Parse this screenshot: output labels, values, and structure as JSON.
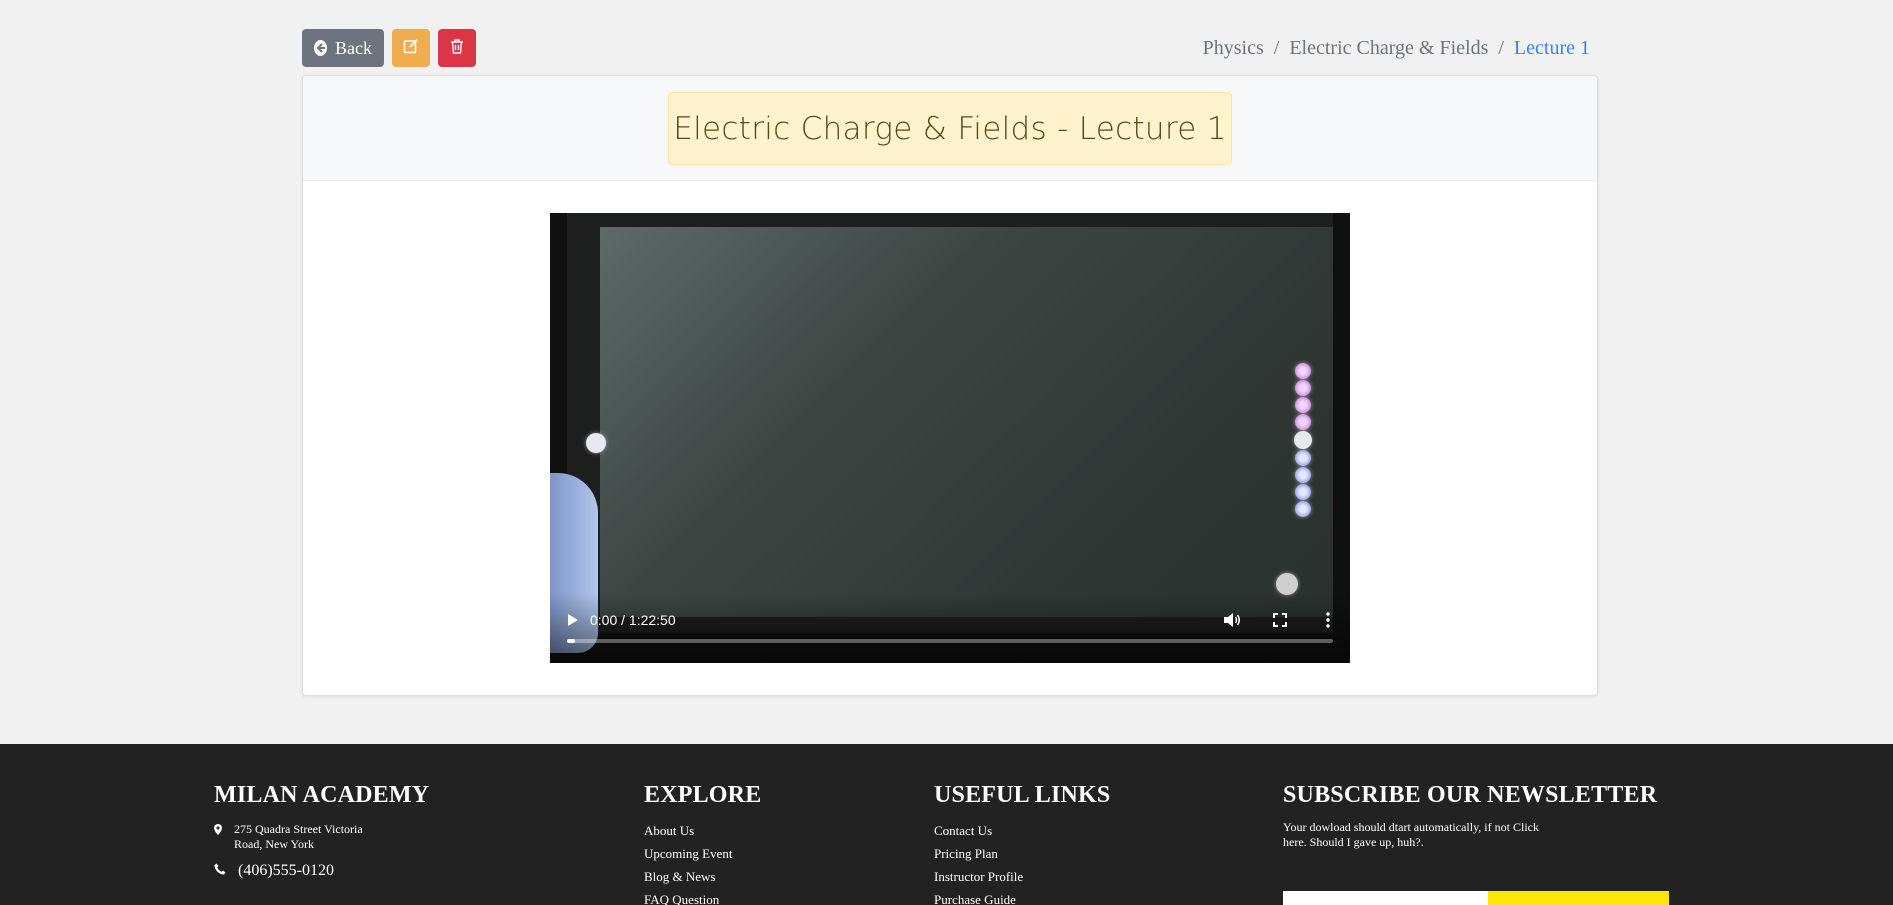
{
  "toolbar": {
    "back_label": "Back"
  },
  "breadcrumb": {
    "items": [
      "Physics",
      "Electric Charge & Fields",
      "Lecture 1"
    ]
  },
  "lecture": {
    "title": "Electric Charge & Fields - Lecture 1"
  },
  "video": {
    "time_display": "0:00 / 1:22:50",
    "progress_fraction": 0.01
  },
  "footer": {
    "brand": "MILAN ACADEMY",
    "address_line1": "275 Quadra Street Victoria",
    "address_line2": "Road, New York",
    "phone": "(406)555-0120",
    "explore": {
      "heading": "EXPLORE",
      "links": [
        "About Us",
        "Upcoming Event",
        "Blog & News",
        "FAQ Question"
      ]
    },
    "useful": {
      "heading": "USEFUL LINKS",
      "links": [
        "Contact Us",
        "Pricing Plan",
        "Instructor Profile",
        "Purchase Guide"
      ]
    },
    "newsletter": {
      "heading": "SUBSCRIBE OUR NEWSLETTER",
      "text": "Your dowload should dtart automatically, if not Click here. Should I gave up, huh?."
    }
  },
  "colors": {
    "back": "#6c757d",
    "edit": "#f0ad4e",
    "delete": "#dc3545",
    "breadcrumb_active": "#3b82f6",
    "title_bg": "#fff3cd",
    "footer_bg": "#222222",
    "newsletter_button": "#ffe60a"
  }
}
